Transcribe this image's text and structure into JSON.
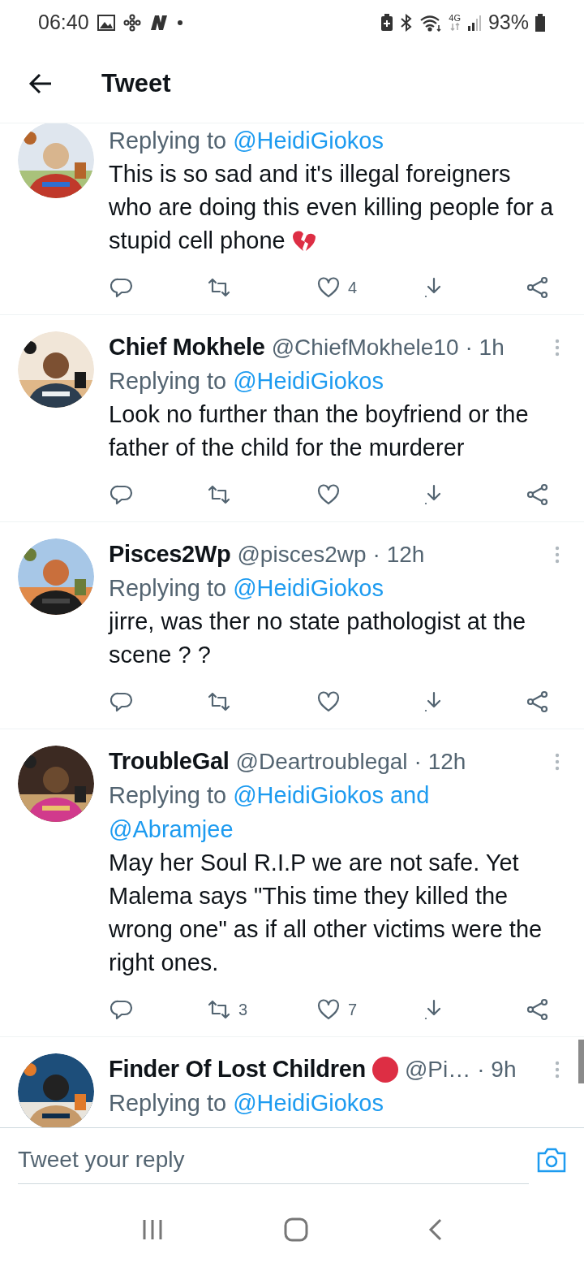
{
  "status_bar": {
    "time": "06:40",
    "battery": "93%",
    "network": "4G"
  },
  "header": {
    "title": "Tweet"
  },
  "tweets": [
    {
      "replying_label": "Replying to",
      "replying_to": "@HeidiGiokos",
      "text": "This is so sad and it's illegal foreigners who are doing this even killing people for a stupid cell phone",
      "likes": "4"
    },
    {
      "name": "Chief Mokhele",
      "handle": "@ChiefMokhele10",
      "time": "· 1h",
      "replying_label": "Replying to",
      "replying_to": "@HeidiGiokos",
      "text": "Look no further than the boyfriend or the father of the child for the murderer"
    },
    {
      "name": "Pisces2Wp",
      "handle": "@pisces2wp",
      "time": "· 12h",
      "replying_label": "Replying to",
      "replying_to": "@HeidiGiokos",
      "text": "jirre, was ther no state pathologist at the scene ? ?"
    },
    {
      "name": "TroubleGal",
      "handle": "@Deartroublegal",
      "time": "· 12h",
      "replying_label": "Replying to",
      "replying_to": "@HeidiGiokos and @Abramjee",
      "text": "May her Soul R.I.P we are not safe. Yet Malema says \"This time they killed the wrong one\" as if all other victims were the right ones.",
      "retweets": "3",
      "likes": "7"
    },
    {
      "name": "Finder Of Lost Children",
      "name_emoji": true,
      "handle": "@Pi…",
      "time": "· 9h",
      "replying_label": "Replying to",
      "replying_to": "@HeidiGiokos"
    }
  ],
  "reply_bar": {
    "placeholder": "Tweet your reply"
  }
}
